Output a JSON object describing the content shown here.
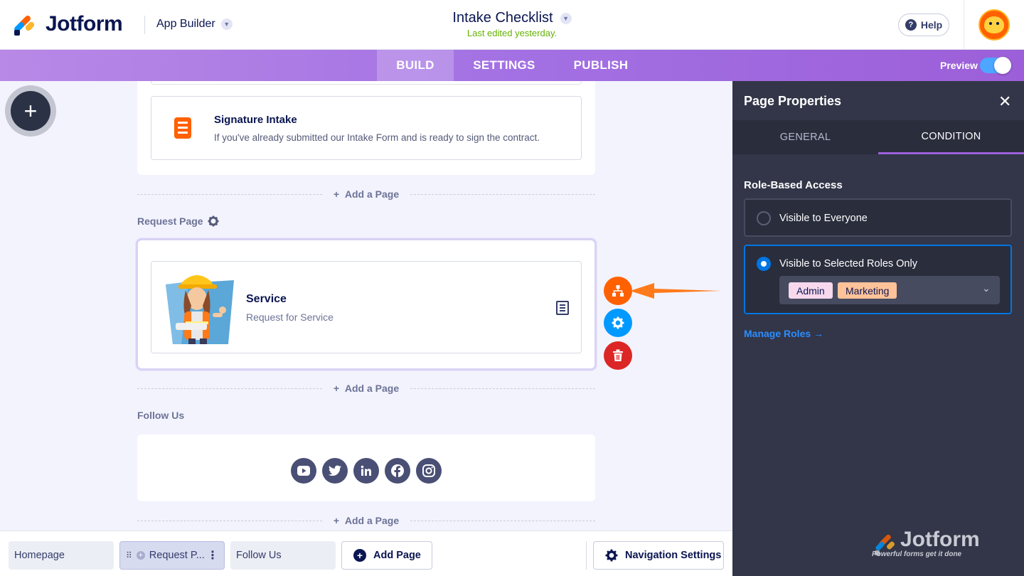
{
  "header": {
    "brand": "Jotform",
    "app_builder_label": "App Builder",
    "title": "Intake Checklist",
    "subtitle": "Last edited yesterday.",
    "help_label": "Help"
  },
  "nav": {
    "tabs": [
      {
        "label": "BUILD",
        "active": true
      },
      {
        "label": "SETTINGS",
        "active": false
      },
      {
        "label": "PUBLISH",
        "active": false
      }
    ],
    "preview_label": "Preview",
    "preview_on": true
  },
  "canvas": {
    "add_page_label": "Add a Page",
    "signature": {
      "title": "Signature Intake",
      "description": "If you've already submitted our Intake Form and is ready to sign the contract."
    },
    "request_page": {
      "label": "Request Page",
      "item_title": "Service",
      "item_description": "Request for Service"
    },
    "follow_us": {
      "label": "Follow Us",
      "icons": [
        "youtube-icon",
        "twitter-icon",
        "linkedin-icon",
        "facebook-icon",
        "instagram-icon"
      ]
    }
  },
  "bottom_bar": {
    "tabs": [
      "Homepage",
      "Request P...",
      "Follow Us"
    ],
    "add_page_label": "Add Page",
    "nav_settings_label": "Navigation Settings"
  },
  "panel": {
    "title": "Page Properties",
    "tabs": [
      "GENERAL",
      "CONDITION"
    ],
    "active_tab": "CONDITION",
    "section_label": "Role-Based Access",
    "option_everyone": "Visible to Everyone",
    "option_selected": "Visible to Selected Roles Only",
    "selected_option": "Visible to Selected Roles Only",
    "roles": [
      "Admin",
      "Marketing"
    ],
    "manage_roles_label": "Manage Roles →",
    "watermark_brand": "Jotform",
    "watermark_tagline": "Powerful forms get it done"
  },
  "colors": {
    "accent_purple": "#9c5fd9",
    "brand_orange": "#ff6100",
    "brand_blue": "#0099ff",
    "danger_red": "#dc2626",
    "panel_bg": "#323648",
    "edited_green": "#64b200"
  }
}
